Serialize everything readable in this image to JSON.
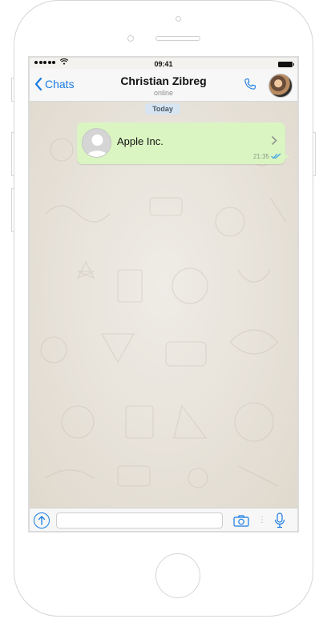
{
  "status_bar": {
    "time": "09:41"
  },
  "nav": {
    "back_label": "Chats",
    "contact_name": "Christian Zibreg",
    "status": "online"
  },
  "chat": {
    "date_divider": "Today",
    "messages": [
      {
        "type": "contact-card",
        "text": "Apple Inc.",
        "time": "21:35",
        "read": true
      }
    ]
  },
  "input": {
    "value": "",
    "placeholder": ""
  },
  "colors": {
    "accent": "#1a7ce4",
    "outgoing_bubble": "#dbf5c2",
    "date_chip": "#d7e4f1",
    "chat_background": "#e9e5dd"
  },
  "icons": [
    "wifi-icon",
    "back-chevron-icon",
    "phone-icon",
    "disclosure-chevron-icon",
    "double-check-icon",
    "attach-icon",
    "camera-icon",
    "microphone-icon"
  ]
}
